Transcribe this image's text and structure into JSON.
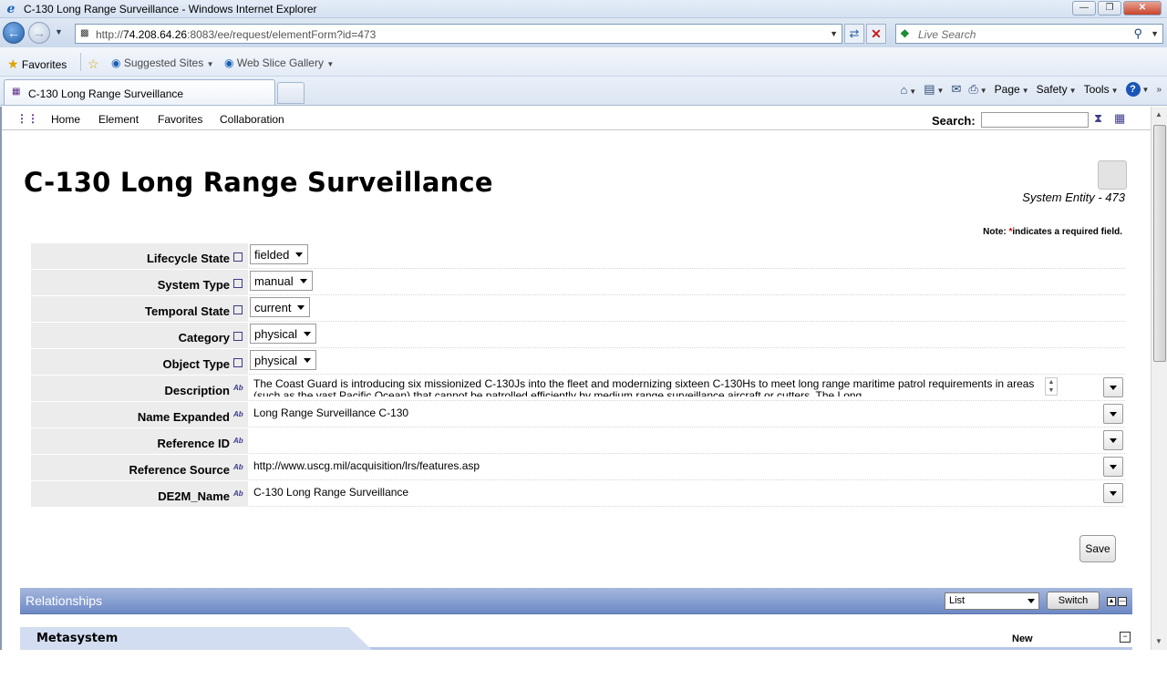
{
  "window": {
    "title": "C-130 Long Range Surveillance - Windows Internet Explorer"
  },
  "address": {
    "url_prefix": "http://",
    "url_host": "74.208.64.26",
    "url_rest": ":8083/ee/request/elementForm?id=473",
    "search_placeholder": "Live Search"
  },
  "favorites_bar": {
    "favorites": "Favorites",
    "suggested_sites": "Suggested Sites",
    "web_slice_gallery": "Web Slice Gallery"
  },
  "tab": {
    "label": "C-130 Long Range Surveillance"
  },
  "command_bar": {
    "page": "Page",
    "safety": "Safety",
    "tools": "Tools",
    "help": "?"
  },
  "app_nav": {
    "items": [
      "Home",
      "Element",
      "Favorites",
      "Collaboration"
    ],
    "search_label": "Search:"
  },
  "page": {
    "title": "C-130 Long Range Surveillance",
    "entity_label": "System Entity - 473",
    "note_prefix": "Note: ",
    "note_star": "*",
    "note_suffix": "indicates a required field."
  },
  "form": {
    "lifecycle_state": {
      "label": "Lifecycle State",
      "value": "fielded"
    },
    "system_type": {
      "label": "System Type",
      "value": "manual"
    },
    "temporal_state": {
      "label": "Temporal State",
      "value": "current"
    },
    "category": {
      "label": "Category",
      "value": "physical"
    },
    "object_type": {
      "label": "Object Type",
      "value": "physical"
    },
    "description": {
      "label": "Description",
      "value": "The Coast Guard is introducing six missionized C-130Js into the fleet and modernizing sixteen C-130Hs to meet long range maritime patrol requirements in areas (such as the vast Pacific Ocean) that cannot be patrolled efficiently by medium range surveillance aircraft or cutters. The Long"
    },
    "name_expanded": {
      "label": "Name Expanded",
      "value": "Long Range Surveillance C-130"
    },
    "reference_id": {
      "label": "Reference ID",
      "value": ""
    },
    "reference_source": {
      "label": "Reference Source",
      "value": "http://www.uscg.mil/acquisition/lrs/features.asp"
    },
    "de2m_name": {
      "label": "DE2M_Name",
      "value": "C-130 Long Range Surveillance"
    }
  },
  "actions": {
    "save": "Save"
  },
  "relationships": {
    "title": "Relationships",
    "view_select": "List",
    "switch": "Switch",
    "section": "Metasystem",
    "new_label": "New"
  },
  "colors": {
    "relationships_bar": "#6d88c4",
    "metasystem_tab": "#d3ddf1",
    "label_cell": "#ececec",
    "logo_accent": "#5b2a86"
  }
}
